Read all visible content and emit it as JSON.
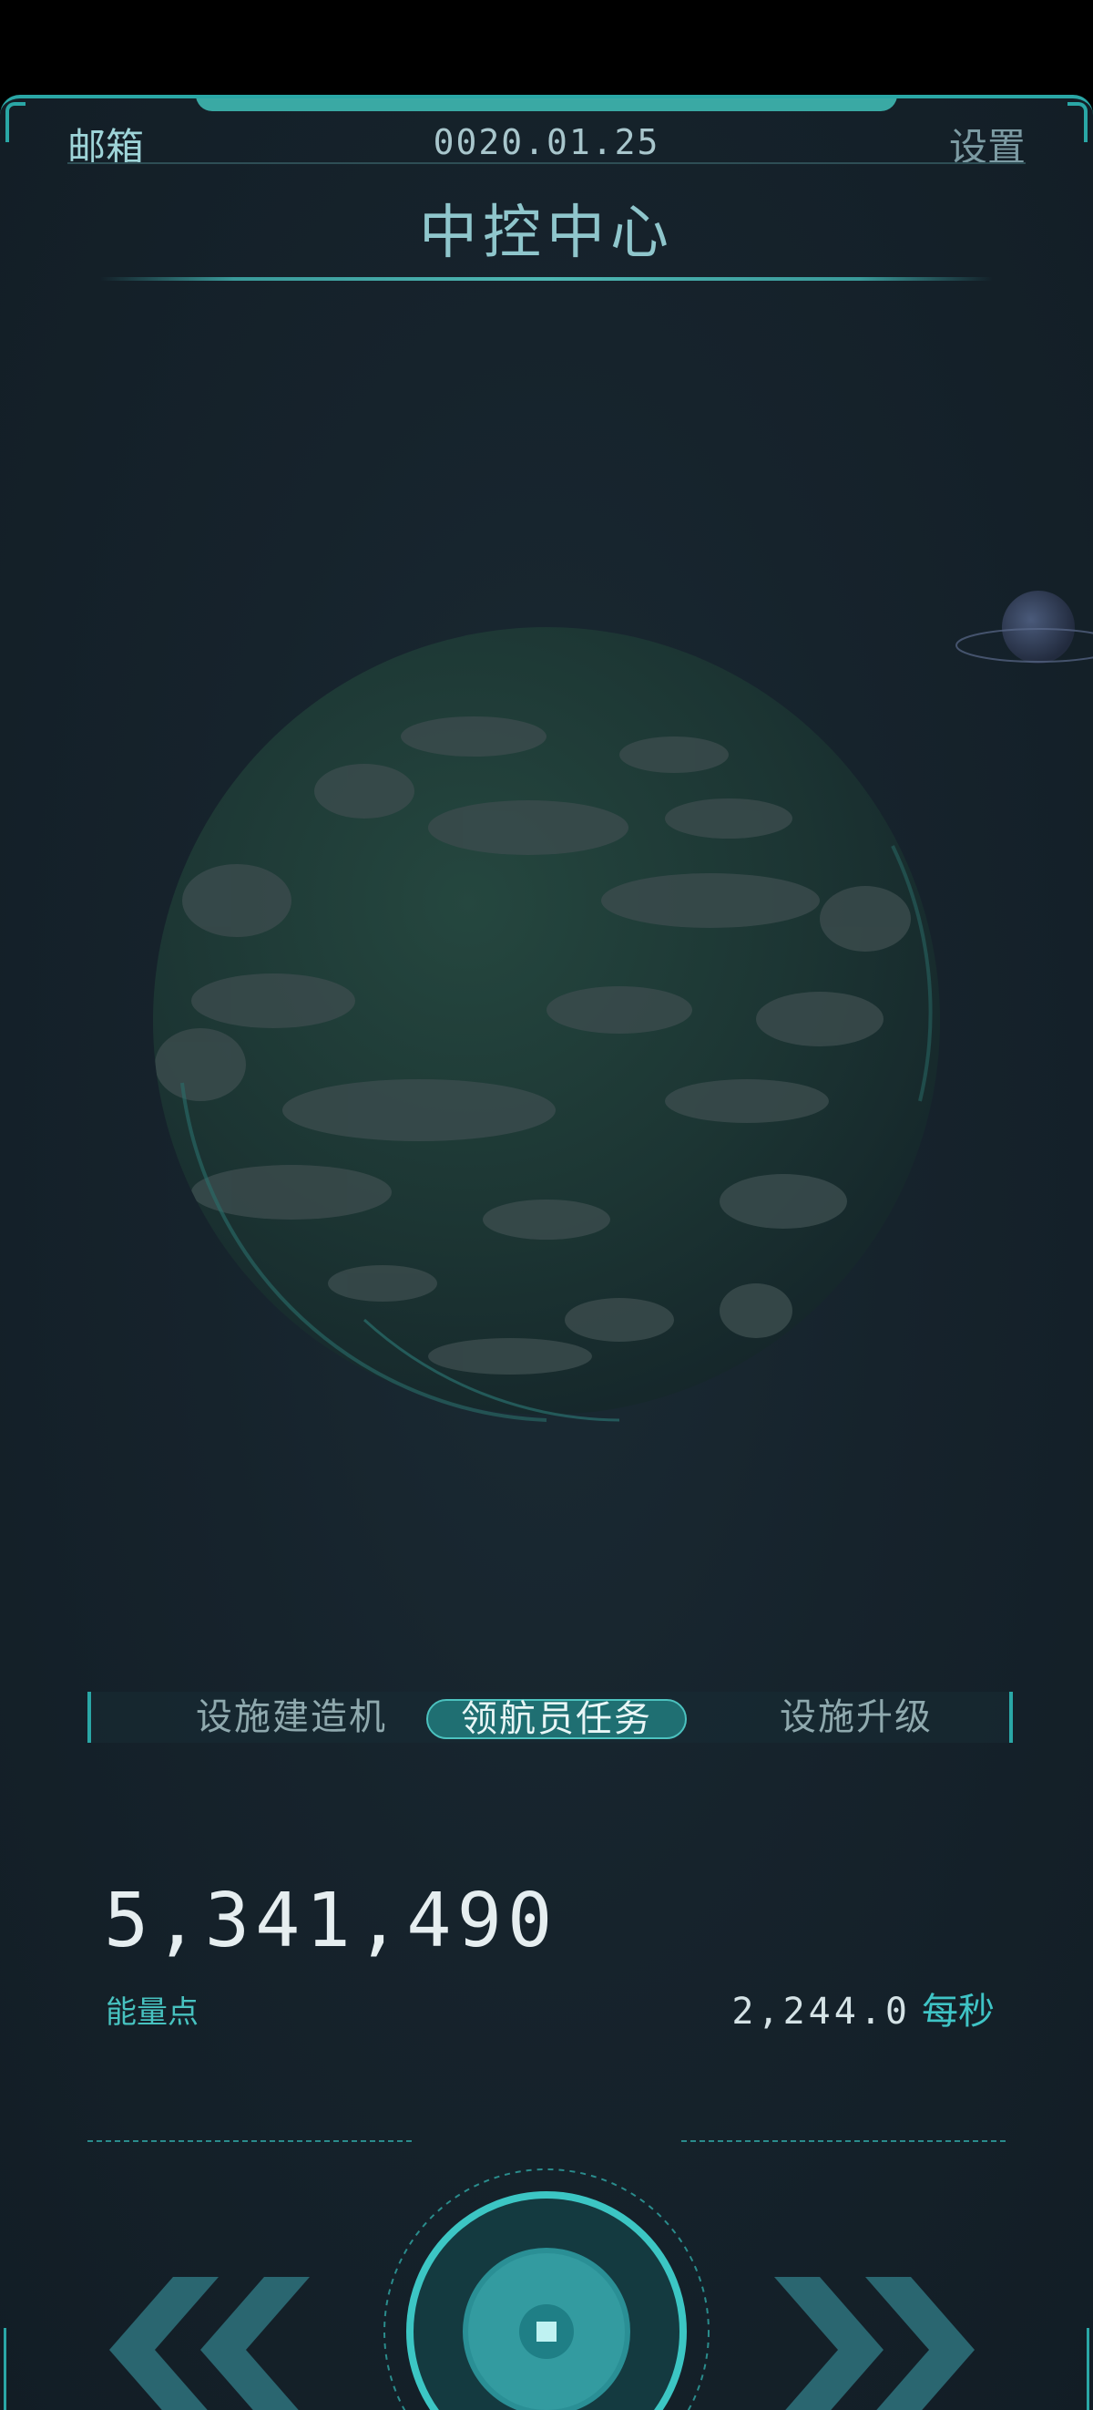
{
  "header": {
    "mail_label": "邮箱",
    "date": "0020.01.25",
    "settings_label": "设置",
    "title": "中控中心"
  },
  "tabs": [
    {
      "label": "设施建造机",
      "active": false
    },
    {
      "label": "领航员任务",
      "active": true
    },
    {
      "label": "设施升级",
      "active": false
    }
  ],
  "energy": {
    "value": "5,341,490",
    "label": "能量点",
    "rate_value": "2,244.0",
    "rate_unit": "每秒"
  },
  "controls": {
    "prev_icon": "double-chevron-left-icon",
    "next_icon": "double-chevron-right-icon",
    "center_icon": "stop-icon"
  },
  "colors": {
    "accent": "#2aa7a6",
    "background": "#16232c",
    "highlight": "#47c2c0"
  }
}
